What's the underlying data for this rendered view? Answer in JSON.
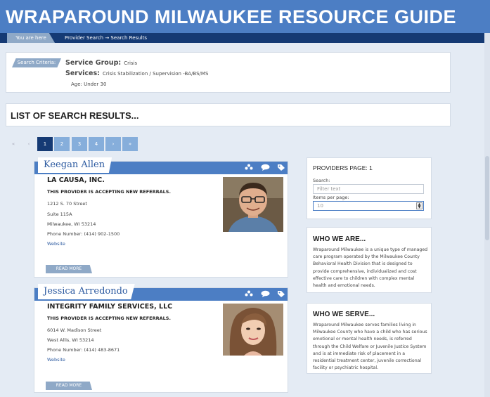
{
  "header": {
    "title": "WRAPAROUND MILWAUKEE RESOURCE GUIDE"
  },
  "breadcrumb": {
    "you_are_here": "You are here",
    "path": "Provider Search  →  Search Results"
  },
  "criteria": {
    "tag": "Search Criteria:",
    "service_group_label": "Service Group:",
    "service_group_value": "Crisis",
    "services_label": "Services:",
    "services_value": "Crisis Stabilization / Supervision -BA/BS/MS",
    "age": "Age:  Under 30"
  },
  "results": {
    "title": "LIST OF SEARCH RESULTS..."
  },
  "pagination": {
    "first": "«",
    "prev": "‹",
    "pages": [
      "1",
      "2",
      "3",
      "4"
    ],
    "next": "›",
    "last": "»",
    "active": "1"
  },
  "providers": [
    {
      "name": "Keegan Allen",
      "org": "LA CAUSA, INC.",
      "status": "THIS PROVIDER IS ACCEPTING NEW REFERRALS.",
      "address": [
        "1212 S. 70 Street",
        "Suite 115A",
        "Milwaukee, WI  53214"
      ],
      "phone": "Phone Number: (414) 902-1500",
      "website": "Website",
      "read_more": "READ MORE"
    },
    {
      "name": "Jessica Arredondo",
      "org": "INTEGRITY FAMILY SERVICES, LLC",
      "status": "THIS PROVIDER IS ACCEPTING NEW REFERRALS.",
      "address": [
        "6014 W. Madison Street",
        "West Allis, WI  53214"
      ],
      "phone": "Phone Number: (414) 483-8671",
      "website": "Website",
      "read_more": "READ MORE"
    }
  ],
  "sidebar": {
    "providers_page": "PROVIDERS PAGE: 1",
    "search_label": "Search:",
    "search_placeholder": "Filter text",
    "items_label": "Items per page:",
    "items_value": "10",
    "who_we_are_title": "WHO WE ARE...",
    "who_we_are_text": "Wraparound Milwaukee is a unique type of managed care program operated by the Milwaukee County Behavioral Health Division that is designed to provide comprehensive, individualized and cost effective care to children with complex mental health and emotional needs.",
    "who_we_serve_title": "WHO WE SERVE...",
    "who_we_serve_text": "Wraparound Milwaukee serves families living in Milwaukee County who have a child who has serious emotional or mental health needs, is referred through the Child Welfare or Juvenile Justice System and is at immediate risk of placement in a residential treatment center, juvenile correctional facility or psychiatric hospital."
  },
  "icons": [
    "group-icon",
    "comment-icon",
    "tag-icon"
  ]
}
